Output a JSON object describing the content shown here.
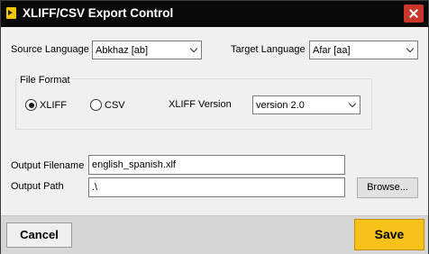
{
  "window": {
    "title": "XLIFF/CSV Export Control",
    "app_icon": "export-icon",
    "close_icon": "close-icon"
  },
  "languages": {
    "source_label": "Source Language",
    "source_value": "Abkhaz [ab]",
    "target_label": "Target Language",
    "target_value": "Afar [aa]"
  },
  "file_format": {
    "group_label": "File Format",
    "options": [
      {
        "label": "XLIFF",
        "checked": true
      },
      {
        "label": "CSV",
        "checked": false
      }
    ],
    "version_label": "XLIFF Version",
    "version_value": "version 2.0"
  },
  "output": {
    "filename_label": "Output Filename",
    "filename_value": "english_spanish.xlf",
    "path_label": "Output Path",
    "path_value": ".\\",
    "browse_label": "Browse..."
  },
  "footer": {
    "cancel_label": "Cancel",
    "save_label": "Save"
  },
  "colors": {
    "titlebar": "#0a0a0a",
    "close": "#c9372c",
    "save": "#f7c21a",
    "footer": "#d6d6d6"
  }
}
